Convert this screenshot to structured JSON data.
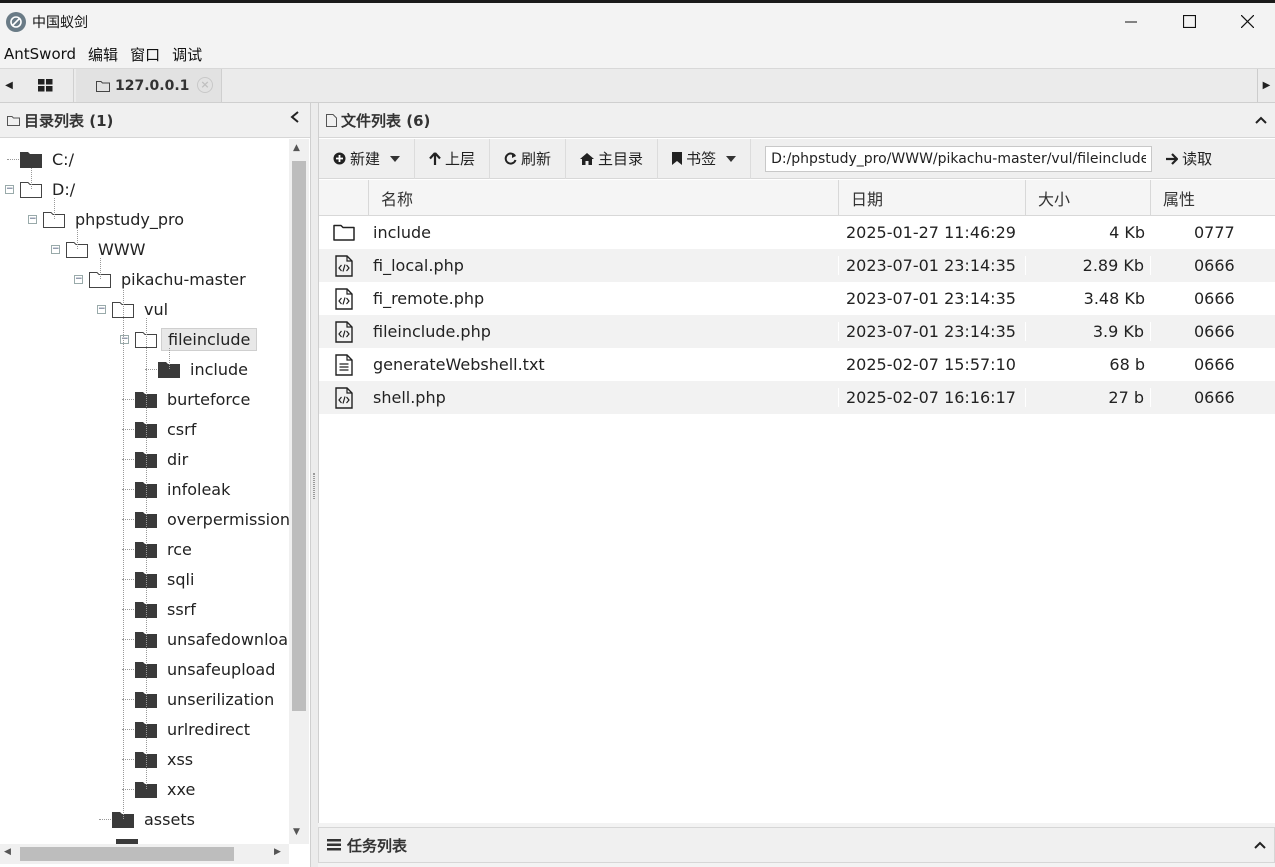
{
  "window": {
    "title": "中国蚁剑",
    "minimize_glyph": "—",
    "maximize_glyph": "☐",
    "close_glyph": "✕"
  },
  "menu": [
    "AntSword",
    "编辑",
    "窗口",
    "调试"
  ],
  "tabs": {
    "active_label": "127.0.0.1",
    "close_glyph": "×"
  },
  "left_panel": {
    "title": "目录列表 (1)",
    "tree": [
      {
        "label": "C:/",
        "depth": 0,
        "state": "none",
        "icon": "folder-filled"
      },
      {
        "label": "D:/",
        "depth": 0,
        "state": "expanded",
        "icon": "folder-open"
      },
      {
        "label": "phpstudy_pro",
        "depth": 1,
        "state": "expanded",
        "icon": "folder-open"
      },
      {
        "label": "WWW",
        "depth": 2,
        "state": "expanded",
        "icon": "folder-open"
      },
      {
        "label": "pikachu-master",
        "depth": 3,
        "state": "expanded",
        "icon": "folder-open"
      },
      {
        "label": "vul",
        "depth": 4,
        "state": "expanded",
        "icon": "folder-open"
      },
      {
        "label": "fileinclude",
        "depth": 5,
        "state": "expanded",
        "icon": "folder-open",
        "selected": true
      },
      {
        "label": "include",
        "depth": 6,
        "state": "none",
        "icon": "folder-filled"
      },
      {
        "label": "burteforce",
        "depth": 5,
        "state": "none",
        "icon": "folder-filled"
      },
      {
        "label": "csrf",
        "depth": 5,
        "state": "none",
        "icon": "folder-filled"
      },
      {
        "label": "dir",
        "depth": 5,
        "state": "none",
        "icon": "folder-filled"
      },
      {
        "label": "infoleak",
        "depth": 5,
        "state": "none",
        "icon": "folder-filled"
      },
      {
        "label": "overpermission",
        "depth": 5,
        "state": "none",
        "icon": "folder-filled"
      },
      {
        "label": "rce",
        "depth": 5,
        "state": "none",
        "icon": "folder-filled"
      },
      {
        "label": "sqli",
        "depth": 5,
        "state": "none",
        "icon": "folder-filled"
      },
      {
        "label": "ssrf",
        "depth": 5,
        "state": "none",
        "icon": "folder-filled"
      },
      {
        "label": "unsafedownload",
        "depth": 5,
        "state": "none",
        "icon": "folder-filled"
      },
      {
        "label": "unsafeupload",
        "depth": 5,
        "state": "none",
        "icon": "folder-filled"
      },
      {
        "label": "unserilization",
        "depth": 5,
        "state": "none",
        "icon": "folder-filled"
      },
      {
        "label": "urlredirect",
        "depth": 5,
        "state": "none",
        "icon": "folder-filled"
      },
      {
        "label": "xss",
        "depth": 5,
        "state": "none",
        "icon": "folder-filled"
      },
      {
        "label": "xxe",
        "depth": 5,
        "state": "none",
        "icon": "folder-filled"
      },
      {
        "label": "assets",
        "depth": 4,
        "state": "none",
        "icon": "folder-filled"
      }
    ]
  },
  "right_panel": {
    "title": "文件列表 (6)",
    "toolbar": {
      "new_label": "新建",
      "up_label": "上层",
      "refresh_label": "刷新",
      "home_label": "主目录",
      "bookmark_label": "书签",
      "path_value": "D:/phpstudy_pro/WWW/pikachu-master/vul/fileinclude/",
      "read_label": "读取"
    },
    "columns": [
      "名称",
      "日期",
      "大小",
      "属性"
    ],
    "files": [
      {
        "name": "include",
        "date": "2025-01-27 11:46:29",
        "size": "4 Kb",
        "attr": "0777",
        "icon": "folder-icon"
      },
      {
        "name": "fi_local.php",
        "date": "2023-07-01 23:14:35",
        "size": "2.89 Kb",
        "attr": "0666",
        "icon": "code-file-icon"
      },
      {
        "name": "fi_remote.php",
        "date": "2023-07-01 23:14:35",
        "size": "3.48 Kb",
        "attr": "0666",
        "icon": "code-file-icon"
      },
      {
        "name": "fileinclude.php",
        "date": "2023-07-01 23:14:35",
        "size": "3.9 Kb",
        "attr": "0666",
        "icon": "code-file-icon"
      },
      {
        "name": "generateWebshell.txt",
        "date": "2025-02-07 15:57:10",
        "size": "68 b",
        "attr": "0666",
        "icon": "text-file-icon"
      },
      {
        "name": "shell.php",
        "date": "2025-02-07 16:16:17",
        "size": "27 b",
        "attr": "0666",
        "icon": "code-file-icon"
      }
    ]
  },
  "task_panel": {
    "title": "任务列表"
  }
}
